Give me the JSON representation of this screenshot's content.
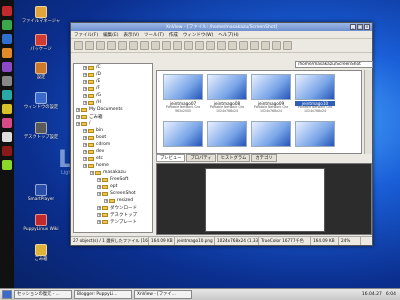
{
  "window": {
    "title": "XnView - [ファイル: /home/masakazu/ScreenShot]",
    "menu": [
      "ファイル(F)",
      "編集(E)",
      "表示(V)",
      "ツール(T)",
      "作成",
      "ウィンドウ(W)",
      "ヘルプ(H)"
    ],
    "path": "/home/masakazu/ScreenShot"
  },
  "tree": [
    {
      "label": "/C",
      "level": 1
    },
    {
      "label": "/D",
      "level": 1
    },
    {
      "label": "/E",
      "level": 1
    },
    {
      "label": "/F",
      "level": 1
    },
    {
      "label": "/G",
      "level": 1
    },
    {
      "label": "/H",
      "level": 1
    },
    {
      "label": "My Documents",
      "level": 0
    },
    {
      "label": "ごみ箱",
      "level": 0
    },
    {
      "label": "/",
      "level": 0
    },
    {
      "label": "bin",
      "level": 1
    },
    {
      "label": "boot",
      "level": 1
    },
    {
      "label": "cdrom",
      "level": 1
    },
    {
      "label": "dev",
      "level": 1
    },
    {
      "label": "etc",
      "level": 1
    },
    {
      "label": "home",
      "level": 1
    },
    {
      "label": "masakazu",
      "level": 2
    },
    {
      "label": "FreeSoft",
      "level": 3
    },
    {
      "label": "opt",
      "level": 3
    },
    {
      "label": "ScreenShot",
      "level": 3
    },
    {
      "label": "resized",
      "level": 4
    },
    {
      "label": "ダウンロード",
      "level": 3
    },
    {
      "label": "デスクトップ",
      "level": 3
    },
    {
      "label": "テンプレート",
      "level": 3
    }
  ],
  "thumbnails": [
    {
      "name": "jeintmago07",
      "sub": "Portable Network Gra",
      "sub2": "963x2000"
    },
    {
      "name": "jeintmago08",
      "sub": "Portable Network Gra",
      "sub2": "1024x768x24"
    },
    {
      "name": "jeintmago09",
      "sub": "Portable Network Gra",
      "sub2": "1024x768x24"
    },
    {
      "name": "jeintmago10",
      "sub": "Portable Network Gra",
      "sub2": "1024x768x24",
      "selected": true
    }
  ],
  "preview_tabs": [
    "プレビュー",
    "プロパティ",
    "ヒストグラム",
    "カテゴリ"
  ],
  "status": [
    "27 object(s) / 1 選択したファイル [164.09 KB]",
    "164.09 KB",
    "jeintmago10.png",
    "1024x768x24 (1.33)",
    "TrueColor 16777千色",
    "164.09 KB",
    "24%"
  ],
  "desktop_icons": [
    {
      "label": "ファイルマネージャ",
      "color": "#e0a53a"
    },
    {
      "label": "パッケージ",
      "color": "#d23b2f"
    },
    {
      "label": "設定",
      "color": "#cc7a2a"
    },
    {
      "label": "ウィンドウの設定",
      "color": "#3a6acb"
    },
    {
      "label": "デスクトップ設定",
      "color": "#5a5a5a"
    },
    {
      "label": "SmartPlayer",
      "color": "#2b4fa8"
    },
    {
      "label": "PuppyLinux Wiki",
      "color": "#c02a2a"
    },
    {
      "label": "ごみ箱",
      "color": "#e0b23a"
    }
  ],
  "brand": {
    "text": "Li",
    "sub": "Light"
  },
  "taskbar": {
    "items": [
      "セッションの復元 - ...",
      "Blogger: PuppyLi...",
      "XnView - [ファイ..."
    ],
    "time": "16.04.27",
    "clock": "6:04"
  }
}
